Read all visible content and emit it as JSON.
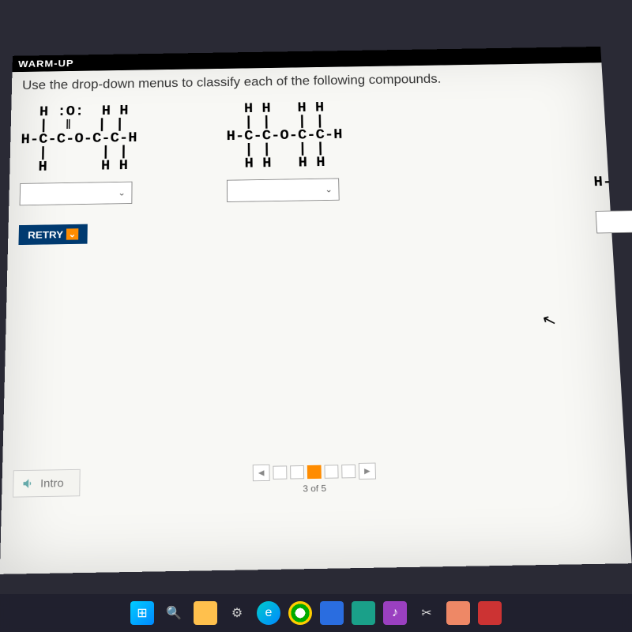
{
  "titlebar": "WARM-UP",
  "instruction": "Use the drop-down menus to classify each of the following compounds.",
  "compounds": {
    "left_structure": "  H :O:  H H\n  |  ‖   | |\nH-C-C-O-C-C-H\n  |      | |\n  H      H H",
    "right_structure": "  H H   H H\n  | |   | |\nH-C-C-O-C-C-H\n  | |   | |\n  H H   H H",
    "partial_structure": "H-"
  },
  "buttons": {
    "retry": "RETRY",
    "intro": "Intro"
  },
  "progress": {
    "current": 3,
    "total": 5,
    "label": "3 of 5"
  },
  "icons": {
    "chevron_down": "⌄",
    "retry_chevron": "⌄",
    "arrow_left": "◀",
    "arrow_right": "▶",
    "cursor": "↖"
  }
}
